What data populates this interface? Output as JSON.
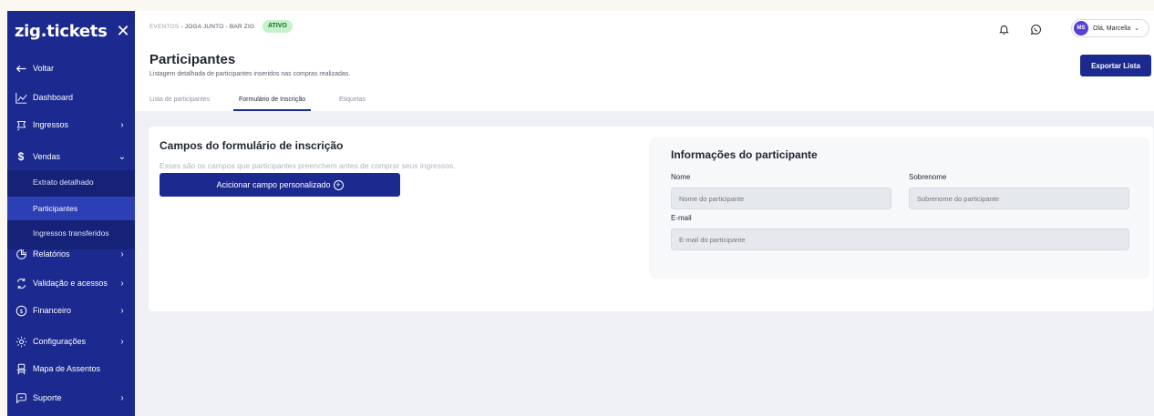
{
  "sidebar": {
    "logo": "zig.tickets",
    "close": "✕",
    "items": [
      {
        "label": "Voltar",
        "icon": "arrow-left-icon"
      },
      {
        "label": "Dashboard",
        "icon": "chart-icon"
      },
      {
        "label": "Ingressos",
        "icon": "ticket-icon",
        "chevron": "›"
      },
      {
        "label": "Vendas",
        "icon": "dollar-icon",
        "chevron": "⌄"
      },
      {
        "label": "Relatórios",
        "icon": "report-icon",
        "chevron": "›"
      },
      {
        "label": "Validação e acessos",
        "icon": "access-icon",
        "chevron": "›"
      },
      {
        "label": "Financeiro",
        "icon": "finance-icon",
        "chevron": "›"
      },
      {
        "label": "Configurações",
        "icon": "gear-icon",
        "chevron": "›"
      },
      {
        "label": "Mapa de Assentos",
        "icon": "seat-icon"
      },
      {
        "label": "Suporte",
        "icon": "support-icon",
        "chevron": "›"
      }
    ],
    "vendas_sub": [
      {
        "label": "Extrato detalhado"
      },
      {
        "label": "Participantes"
      },
      {
        "label": "Ingressos transferidos"
      }
    ]
  },
  "header": {
    "breadcrumb_root": "EVENTOS",
    "breadcrumb_sep": "›",
    "breadcrumb_current": "JOGA JUNTO - BAR ZIG",
    "status_badge": "ATIVO",
    "title": "Participantes",
    "subtitle": "Listagem detalhada de participantes inseridos nas compras realizadas.",
    "export_button": "Exportar Lista",
    "user_initials": "MS",
    "user_greeting": "Olá, Marcella",
    "user_chevron": "⌄"
  },
  "tabs": [
    {
      "label": "Lista de participantes"
    },
    {
      "label": "Formulário de Inscrição",
      "active": true
    },
    {
      "label": "Etiquetas"
    }
  ],
  "form_section": {
    "title": "Campos do formulário de inscrição",
    "description": "Esses são os campos que participantes preenchem antes de comprar seus ingressos.",
    "add_button": "Acicionar campo personalizado",
    "add_button_icon": "+"
  },
  "participant_info": {
    "title": "Informações do participante",
    "first_name_label": "Nome",
    "first_name_placeholder": "Nome do participante",
    "last_name_label": "Sobrenome",
    "last_name_placeholder": "Sobrenome do participante",
    "email_label": "E-mail",
    "email_placeholder": "E-mail do participante"
  },
  "colors": {
    "brand": "#1c2a8f",
    "active_badge_bg": "#c6f1c9",
    "active_badge_text": "#12702a"
  }
}
